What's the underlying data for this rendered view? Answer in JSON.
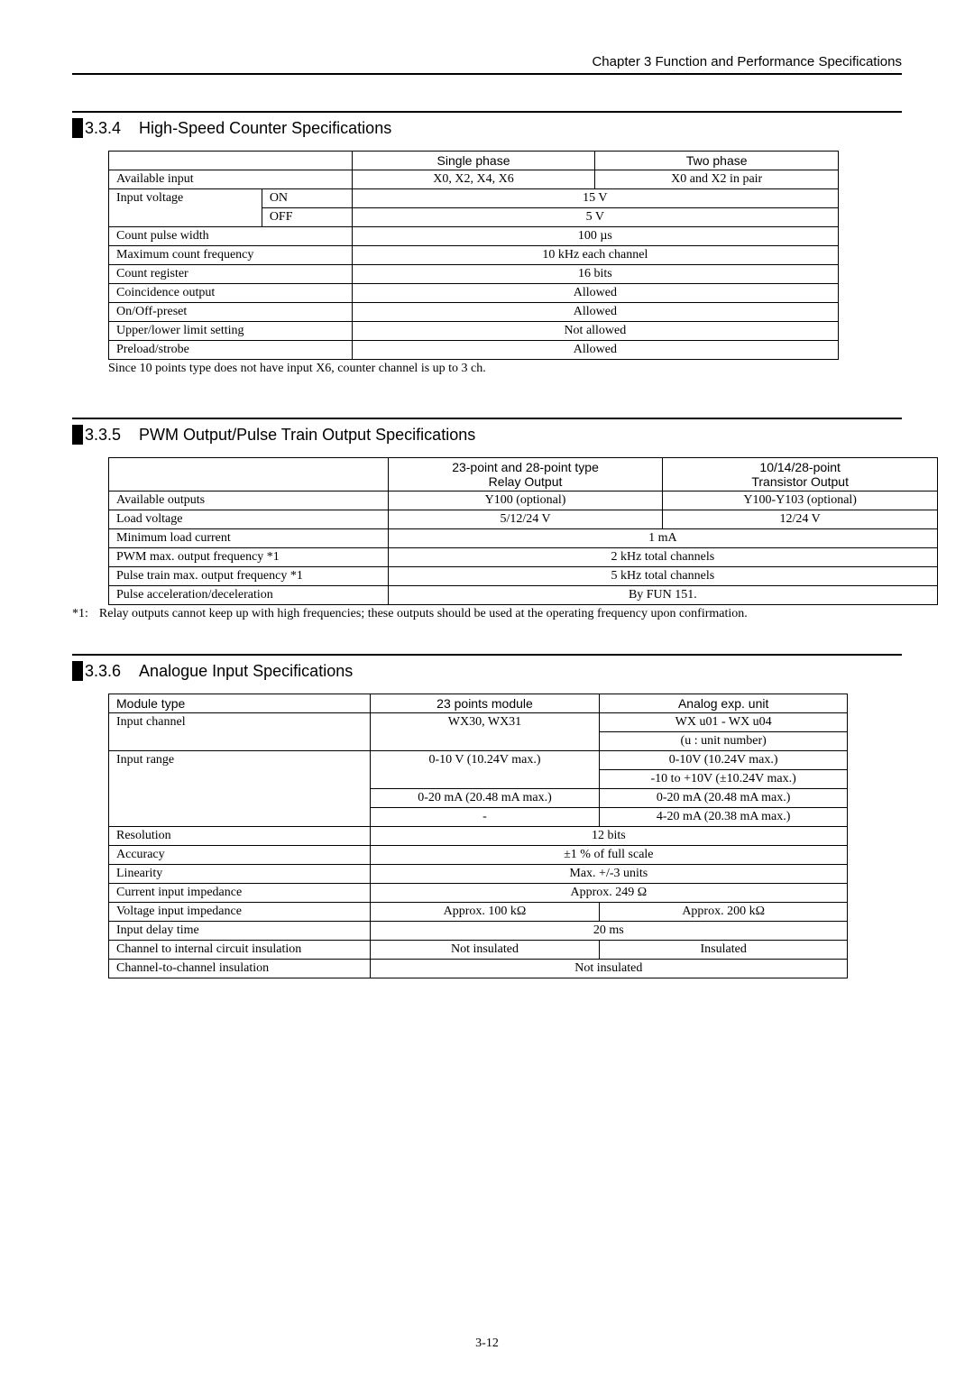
{
  "header": {
    "chapter": "Chapter 3  Function and Performance Specifications"
  },
  "section334": {
    "num": "3.3.4",
    "title": "High-Speed Counter Specifications",
    "table": {
      "h_single": "Single phase",
      "h_two": "Two phase",
      "r_avail": "Available input",
      "r_avail_single": "X0, X2, X4, X6",
      "r_avail_two": "X0 and X2 in pair",
      "r_inputv": "Input voltage",
      "r_on": "ON",
      "r_on_v": "15 V",
      "r_off": "OFF",
      "r_off_v": "5 V",
      "r_pulse": "Count pulse width",
      "r_pulse_v": "100 µs",
      "r_maxfreq": "Maximum count frequency",
      "r_maxfreq_v": "10 kHz each channel",
      "r_countreg": "Count register",
      "r_countreg_v": "16 bits",
      "r_coin": "Coincidence output",
      "r_coin_v": "Allowed",
      "r_onoff": "On/Off-preset",
      "r_onoff_v": "Allowed",
      "r_limit": "Upper/lower limit setting",
      "r_limit_v": "Not allowed",
      "r_preload": "Preload/strobe",
      "r_preload_v": "Allowed"
    },
    "caption": "Since 10 points type does not have input X6, counter channel is up to 3 ch."
  },
  "section335": {
    "num": "3.3.5",
    "title": "PWM Output/Pulse Train Output Specifications",
    "table": {
      "h_relay_l1": "23-point and 28-point type",
      "h_relay_l2": "Relay Output",
      "h_trans_l1": "10/14/28-point",
      "h_trans_l2": "Transistor Output",
      "r_avail": "Available outputs",
      "r_avail_relay": "Y100 (optional)",
      "r_avail_trans": "Y100-Y103 (optional)",
      "r_loadv": "Load voltage",
      "r_loadv_relay": "5/12/24 V",
      "r_loadv_trans": "12/24 V",
      "r_minload": "Minimum load current",
      "r_minload_v": "1 mA",
      "r_pwm": "PWM max. output frequency *1",
      "r_pwm_v": "2 kHz total channels",
      "r_pulsetrain": "Pulse train max. output frequency *1",
      "r_pulsetrain_v": "5 kHz total channels",
      "r_accel": "Pulse acceleration/deceleration",
      "r_accel_v": "By FUN 151."
    },
    "footnote_label": "*1:",
    "footnote": "Relay outputs cannot keep up with high frequencies; these outputs should be used at the operating frequency upon confirmation."
  },
  "section336": {
    "num": "3.3.6",
    "title": "Analogue Input Specifications",
    "table": {
      "h_module": "Module type",
      "h_23": "23 points module",
      "h_analog": "Analog exp. unit",
      "r_inputch": "Input channel",
      "r_inputch_23": "WX30, WX31",
      "r_inputch_an_l1": "WX u01 - WX u04",
      "r_inputch_an_l2": "(u : unit number)",
      "r_range": "Input range",
      "r_range_23_l1": "0-10 V (10.24V max.)",
      "r_range_an_l1": "0-10V (10.24V max.)",
      "r_range_an_l2": "-10 to +10V (±10.24V max.)",
      "r_range_23_l3": "0-20 mA (20.48 mA max.)",
      "r_range_an_l3": "0-20 mA (20.48 mA max.)",
      "r_range_23_l4": "-",
      "r_range_an_l4": "4-20 mA (20.38 mA max.)",
      "r_reso": "Resolution",
      "r_reso_v": "12 bits",
      "r_acc": "Accuracy",
      "r_acc_v": "±1 % of full scale",
      "r_lin": "Linearity",
      "r_lin_v": "Max. +/-3 units",
      "r_curimp": "Current input impedance",
      "r_curimp_v": "Approx. 249 Ω",
      "r_volimp": "Voltage input impedance",
      "r_volimp_23": "Approx. 100 kΩ",
      "r_volimp_an": "Approx. 200 kΩ",
      "r_delay": "Input delay time",
      "r_delay_v": "20 ms",
      "r_chint": "Channel to internal circuit insulation",
      "r_chint_23": "Not insulated",
      "r_chint_an": "Insulated",
      "r_chch": "Channel-to-channel insulation",
      "r_chch_v": "Not insulated"
    }
  },
  "page_number": "3-12"
}
